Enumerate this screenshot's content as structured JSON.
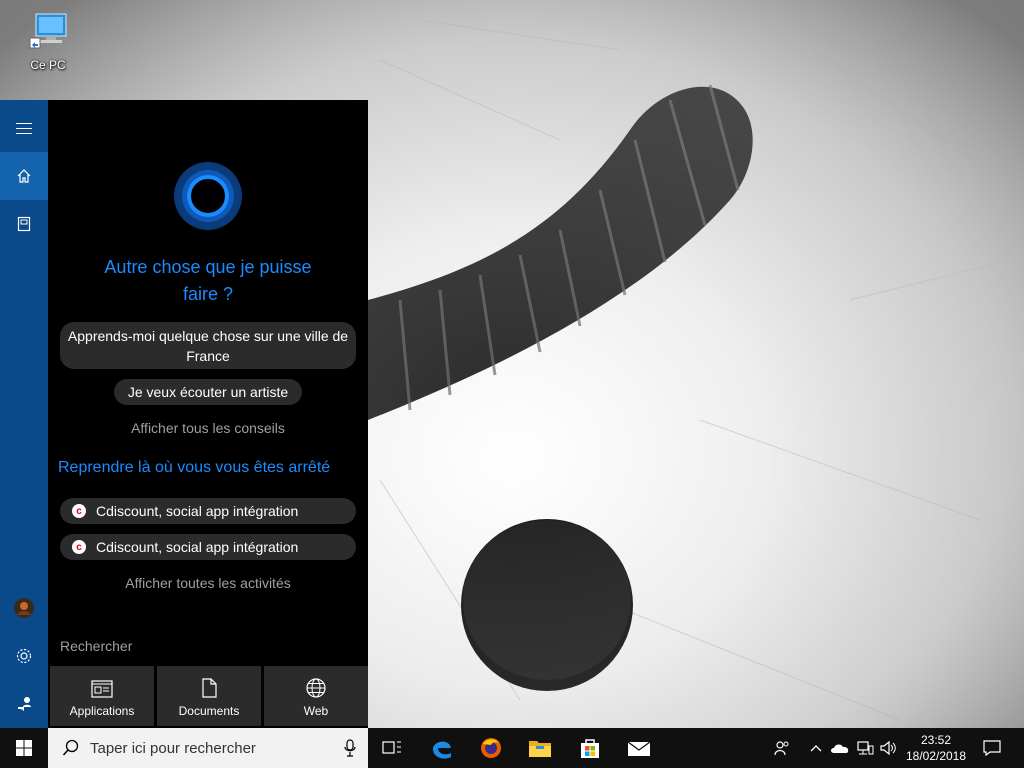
{
  "desktop": {
    "icon_label": "Ce PC"
  },
  "cortana": {
    "title": "Autre chose que je puisse faire ?",
    "suggestions": [
      "Apprends-moi quelque chose sur une ville de France",
      "Je veux écouter un artiste"
    ],
    "show_all_tips": "Afficher tous les conseils",
    "resume_title": "Reprendre là où vous vous êtes arrêté",
    "activities": [
      "Cdiscount, social app intégration",
      "Cdiscount, social app intégration"
    ],
    "show_all_activities": "Afficher toutes les activités",
    "search_label": "Rechercher",
    "filters": [
      "Applications",
      "Documents",
      "Web"
    ]
  },
  "taskbar": {
    "search_placeholder": "Taper ici pour rechercher",
    "time": "23:52",
    "date": "18/02/2018"
  },
  "colors": {
    "accent": "#1a8cff",
    "rail": "#0b4a8a",
    "rail_active": "#1463ad",
    "panel_bg": "#000000",
    "pill_bg": "#2b2b2b",
    "taskbar_bg": "#101010"
  },
  "icons": {
    "rail": [
      "hamburger-icon",
      "home-icon",
      "notebook-icon",
      "avatar",
      "gear-icon",
      "feedback-icon"
    ],
    "taskbar": [
      "windows-icon",
      "search-icon",
      "microphone-icon",
      "task-view-icon",
      "edge-icon",
      "firefox-icon",
      "file-explorer-icon",
      "store-icon",
      "mail-icon"
    ],
    "tray": [
      "people-icon",
      "chevron-up-icon",
      "onedrive-icon",
      "network-icon",
      "volume-icon",
      "action-center-icon"
    ]
  }
}
